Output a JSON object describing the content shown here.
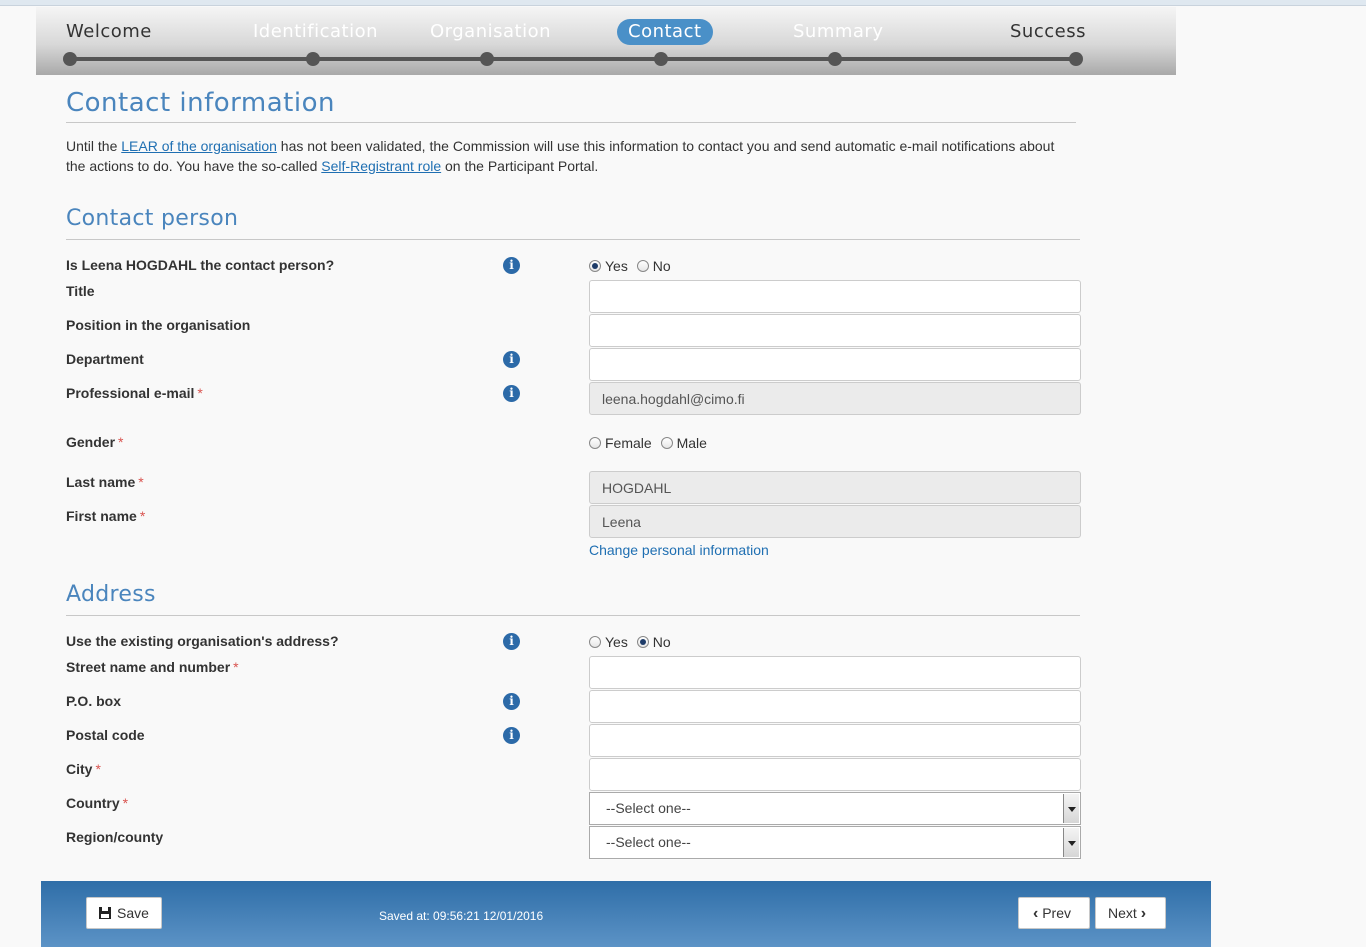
{
  "wizard": {
    "steps": [
      "Welcome",
      "Identification",
      "Organisation",
      "Contact",
      "Summary",
      "Success"
    ],
    "active": "Contact"
  },
  "page": {
    "title": "Contact information",
    "intro": {
      "t1": "Until the ",
      "lear_link": "LEAR of the organisation",
      "t2": " has not been validated, the Commission will use this information to contact you and send automatic e-mail notifications about the actions to do. You have the so-called ",
      "role_link": "Self-Registrant role",
      "t3": " on the Participant Portal."
    }
  },
  "contact": {
    "heading": "Contact person",
    "is_contact_label": "Is Leena HOGDAHL the contact person?",
    "yes": "Yes",
    "no": "No",
    "is_contact_value": "Yes",
    "title_label": "Title",
    "title_value": "",
    "position_label": "Position in the organisation",
    "position_value": "",
    "department_label": "Department",
    "department_value": "",
    "email_label": "Professional e-mail",
    "email_value": "leena.hogdahl@cimo.fi",
    "gender_label": "Gender",
    "female": "Female",
    "male": "Male",
    "gender_value": "",
    "lastname_label": "Last name",
    "lastname_value": "HOGDAHL",
    "firstname_label": "First name",
    "firstname_value": "Leena",
    "change_link": "Change personal information",
    "required_mark": "*"
  },
  "address": {
    "heading": "Address",
    "use_existing_label": "Use the existing organisation's address?",
    "use_existing_value": "No",
    "street_label": "Street name and number",
    "street_value": "",
    "pobox_label": "P.O. box",
    "pobox_value": "",
    "postal_label": "Postal code",
    "postal_value": "",
    "city_label": "City",
    "city_value": "",
    "country_label": "Country",
    "country_value": "--Select one--",
    "region_label": "Region/county",
    "region_value": "--Select one--"
  },
  "footer": {
    "save_label": "Save",
    "saved_text": "Saved at: 09:56:21 12/01/2016",
    "prev_label": "Prev",
    "next_label": "Next"
  },
  "colors": {
    "accent": "#4a90c8",
    "heading": "#4a85bd",
    "footer": "#2f6ea8",
    "required": "#d9534f"
  }
}
